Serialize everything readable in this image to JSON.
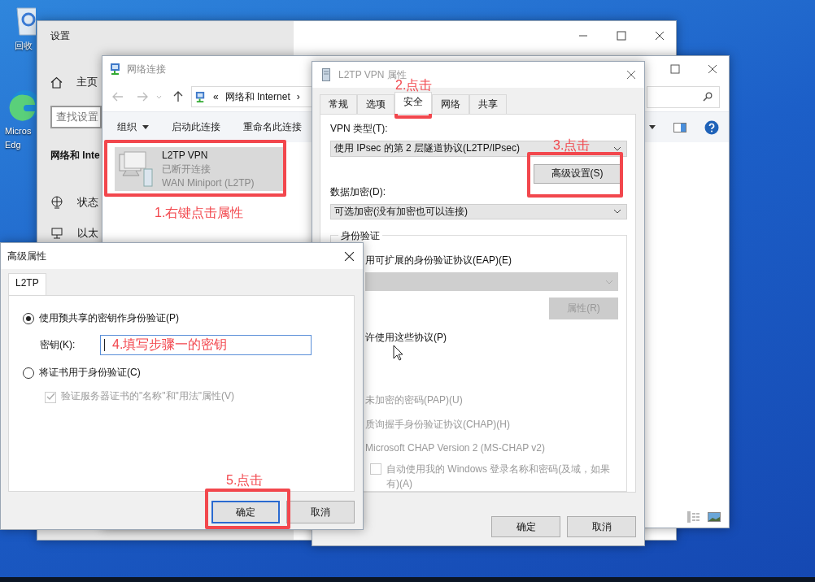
{
  "desktop": {
    "icons": [
      {
        "kind": "recycle",
        "label": "回收"
      },
      {
        "kind": "edge",
        "label": "Micros Edg"
      }
    ]
  },
  "settings_window": {
    "title": "设置",
    "home": "主页",
    "search": {
      "placeholder": "查找设置"
    },
    "section_title": "网络和 Inte",
    "nav": [
      {
        "kind": "globe",
        "label": "状态"
      },
      {
        "kind": "ethernet",
        "label": "以太"
      }
    ]
  },
  "network_window": {
    "title": "网络连接",
    "breadcrumb": [
      "«",
      "网络和 Internet",
      "›"
    ],
    "toolbar": [
      {
        "label": "组织",
        "dropdown": true
      },
      {
        "label": "启动此连接",
        "dropdown": false
      },
      {
        "label": "重命名此连接",
        "dropdown": false
      }
    ],
    "connections": [
      {
        "name": "L2TP VPN",
        "status": "已断开连接",
        "device": "WAN Miniport (L2TP)",
        "selected": true
      }
    ]
  },
  "vpn_dialog": {
    "title": "L2TP VPN 属性",
    "tabs": [
      {
        "label": "常规",
        "selected": false
      },
      {
        "label": "选项",
        "selected": false
      },
      {
        "label": "安全",
        "selected": true
      },
      {
        "label": "网络",
        "selected": false
      },
      {
        "label": "共享",
        "selected": false
      }
    ],
    "vpn_type": {
      "label": "VPN 类型(T):",
      "value": "使用 IPsec 的第 2 层隧道协议(L2TP/IPsec)"
    },
    "advanced_button": "高级设置(S)",
    "encryption": {
      "label": "数据加密(D):",
      "value": "可选加密(没有加密也可以连接)"
    },
    "auth": {
      "legend": "身份验证",
      "eap_option": "用可扩展的身份验证协议(EAP)(E)",
      "eap_properties": {
        "label": "属性(R)",
        "disabled": true
      },
      "protocols_option": "许使用这些协议(P)",
      "protocols": [
        {
          "label": "未加密的密码(PAP)(U)",
          "disabled": true
        },
        {
          "label": "质询握手身份验证协议(CHAP)(H)",
          "disabled": true
        },
        {
          "label": "Microsoft CHAP Version 2 (MS-CHAP v2)",
          "disabled": true
        }
      ],
      "auto_login": {
        "label": "自动使用我的 Windows 登录名称和密码(及域，如果有)(A)",
        "checked": false,
        "disabled": true
      }
    },
    "buttons": [
      "确定",
      "取消"
    ]
  },
  "advanced_dialog": {
    "title": "高级属性",
    "tabs": [
      {
        "label": "L2TP",
        "selected": true
      }
    ],
    "options": [
      {
        "kind": "radio",
        "label": "使用预共享的密钥作身份验证(P)",
        "selected": true
      },
      {
        "kind": "key",
        "label": "密钥(K):",
        "value": "4.填写步骤一的密钥"
      },
      {
        "kind": "radio",
        "label": "将证书用于身份验证(C)",
        "selected": false
      },
      {
        "kind": "checkbox",
        "label": "验证服务器证书的\"名称\"和\"用法\"属性(V)",
        "checked": true,
        "disabled": true
      }
    ],
    "buttons": [
      {
        "label": "确定",
        "default": true
      },
      {
        "label": "取消",
        "default": false
      }
    ]
  },
  "annotations": [
    {
      "text": "1.右键点击属性"
    },
    {
      "text": "2.点击"
    },
    {
      "text": "3.点击"
    },
    {
      "text": "5.点击"
    }
  ]
}
